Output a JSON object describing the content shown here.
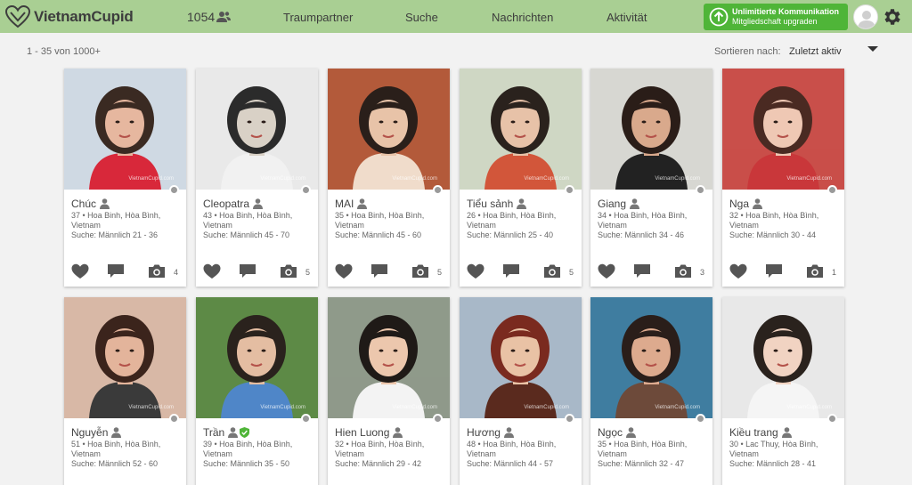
{
  "header": {
    "brand": "VietnamCupid",
    "member_count": "1054",
    "nav": [
      "Traumpartner",
      "Suche",
      "Nachrichten",
      "Aktivität"
    ],
    "upgrade_line1": "Unlimitierte Kommunikation",
    "upgrade_line2": "Mitgliedschaft upgraden",
    "colors": {
      "bar": "#a9cf93",
      "upgrade": "#4fb538"
    }
  },
  "toolbar": {
    "result_count": "1 - 35 von 1000+",
    "sort_label": "Sortieren nach:",
    "sort_value": "Zuletzt aktiv"
  },
  "watermark": "VietnamCupid.com",
  "profiles": [
    {
      "name": "Chúc",
      "location": "37 • Hoa Binh, Hòa Bình, Vietnam",
      "seeking": "Suche: Männlich 21 - 36",
      "photos": "4",
      "verified": false,
      "skin": "#e6b79f",
      "hair": "#3a2a22",
      "bg": "#cfd9e3",
      "shirt": "#d8283a"
    },
    {
      "name": "Cleopatra",
      "location": "43 • Hoa Binh, Hòa Bình, Vietnam",
      "seeking": "Suche: Männlich 45 - 70",
      "photos": "5",
      "verified": false,
      "skin": "#d9d1c6",
      "hair": "#2b2b2b",
      "bg": "#e9e9e9",
      "shirt": "#f1f1f1"
    },
    {
      "name": "MAI",
      "location": "35 • Hoa Binh, Hòa Bình, Vietnam",
      "seeking": "Suche: Männlich 45 - 60",
      "photos": "5",
      "verified": false,
      "skin": "#e8c3a8",
      "hair": "#2a1f1a",
      "bg": "#b35a3a",
      "shirt": "#f0dccb"
    },
    {
      "name": "Tiểu sảnh",
      "location": "26 • Hoa Binh, Hòa Bình, Vietnam",
      "seeking": "Suche: Männlich 25 - 40",
      "photos": "5",
      "verified": false,
      "skin": "#e7c2a8",
      "hair": "#2a221d",
      "bg": "#cfd7c4",
      "shirt": "#d2563a"
    },
    {
      "name": "Giang",
      "location": "34 • Hoa Binh, Hòa Bình, Vietnam",
      "seeking": "Suche: Männlich 34 - 46",
      "photos": "3",
      "verified": false,
      "skin": "#d9a98c",
      "hair": "#2a1d18",
      "bg": "#d7d7d2",
      "shirt": "#222222"
    },
    {
      "name": "Nga",
      "location": "32 • Hoa Binh, Hòa Bình, Vietnam",
      "seeking": "Suche: Männlich 30 - 44",
      "photos": "1",
      "verified": false,
      "skin": "#efc8b4",
      "hair": "#4a2a22",
      "bg": "#c94f4a",
      "shirt": "#c9373a"
    },
    {
      "name": "Nguyễn",
      "location": "51 • Hoa Binh, Hòa Bình, Vietnam",
      "seeking": "Suche: Männlich 52 - 60",
      "photos": "",
      "verified": false,
      "skin": "#e3b49b",
      "hair": "#3b241c",
      "bg": "#d8b8a6",
      "shirt": "#3a3a3a"
    },
    {
      "name": "Trần",
      "location": "39 • Hoa Binh, Hòa Bình, Vietnam",
      "seeking": "Suche: Männlich 35 - 50",
      "photos": "",
      "verified": true,
      "skin": "#e4bda2",
      "hair": "#2a221d",
      "bg": "#5d8a46",
      "shirt": "#4f86c8"
    },
    {
      "name": "Hien Luong",
      "location": "32 • Hoa Binh, Hòa Bình, Vietnam",
      "seeking": "Suche: Männlich 29 - 42",
      "photos": "",
      "verified": false,
      "skin": "#ecc7ad",
      "hair": "#1f1a17",
      "bg": "#8f9a8a",
      "shirt": "#f3f3f3"
    },
    {
      "name": "Hương",
      "location": "48 • Hoa Binh, Hòa Bình, Vietnam",
      "seeking": "Suche: Männlich 44 - 57",
      "photos": "",
      "verified": false,
      "skin": "#e9c2a5",
      "hair": "#7a2a1f",
      "bg": "#a8b8c8",
      "shirt": "#5a2a1e"
    },
    {
      "name": "Ngọc",
      "location": "35 • Hoa Binh, Hòa Bình, Vietnam",
      "seeking": "Suche: Männlich 32 - 47",
      "photos": "",
      "verified": false,
      "skin": "#ddaa8e",
      "hair": "#2a1e1a",
      "bg": "#3f7da0",
      "shirt": "#6d4a3a"
    },
    {
      "name": "Kiều trang",
      "location": "30 • Lac Thuy, Hòa Bình, Vietnam",
      "seeking": "Suche: Männlich 28 - 41",
      "photos": "",
      "verified": false,
      "skin": "#f1d3c2",
      "hair": "#2a221d",
      "bg": "#e8e8e8",
      "shirt": "#f5f5f5"
    }
  ]
}
